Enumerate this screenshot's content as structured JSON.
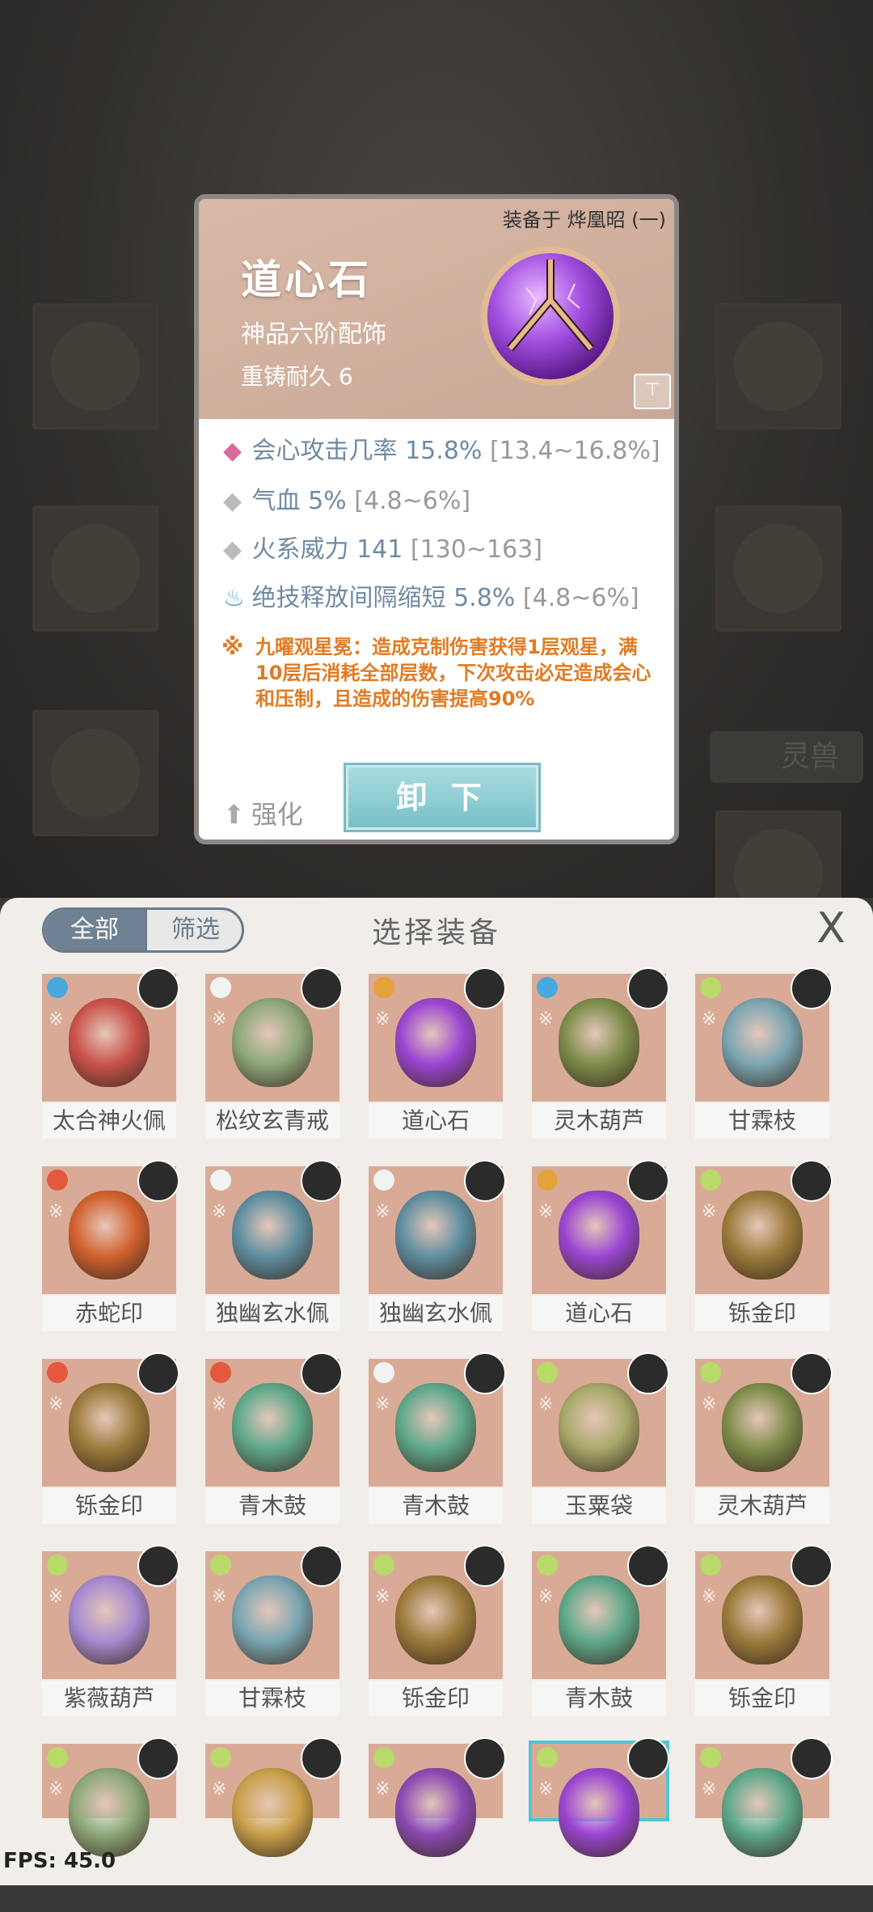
{
  "detail": {
    "equipped_on": "装备于 烨凰昭 (一)",
    "name": "道心石",
    "grade": "神品六阶配饰",
    "durability": "重铸耐久 6",
    "stats": [
      {
        "name": "会心攻击几率 15.8%",
        "range": "[13.4~16.8%]"
      },
      {
        "name": "气血 5%",
        "range": "[4.8~6%]"
      },
      {
        "name": "火系威力 141",
        "range": "[130~163]"
      },
      {
        "name": "绝技释放间隔缩短 5.8%",
        "range": "[4.8~6%]"
      }
    ],
    "effect": "九曜观星冕：造成克制伤害获得1层观星，满10层后消耗全部层数，下次攻击必定造成会心和压制，且造成的伤害提高90%",
    "upgrade_label": "强化",
    "unequip_label": "卸 下"
  },
  "background": {
    "tab_label": "灵兽"
  },
  "panel": {
    "title": "选择装备",
    "tab_all": "全部",
    "tab_filter": "筛选",
    "close_label": "X"
  },
  "items": [
    {
      "name": "太合神火佩",
      "element": "#49a8dd",
      "color": "#c9524a"
    },
    {
      "name": "松纹玄青戒",
      "element": "#f2f2f2",
      "color": "#8ea87a"
    },
    {
      "name": "道心石",
      "element": "#e6a23a",
      "color": "#9a45d2"
    },
    {
      "name": "灵木葫芦",
      "element": "#49a8dd",
      "color": "#7d8c4a"
    },
    {
      "name": "甘霖枝",
      "element": "#b9d96a",
      "color": "#7aa6b2"
    },
    {
      "name": "赤蛇印",
      "element": "#e4583e",
      "color": "#d1612e"
    },
    {
      "name": "独幽玄水佩",
      "element": "#f2f2f2",
      "color": "#5e8ea0"
    },
    {
      "name": "独幽玄水佩",
      "element": "#f2f2f2",
      "color": "#5e8ea0"
    },
    {
      "name": "道心石",
      "element": "#e6a23a",
      "color": "#9a45d2"
    },
    {
      "name": "铄金印",
      "element": "#b9d96a",
      "color": "#9b7a3a"
    },
    {
      "name": "铄金印",
      "element": "#e4583e",
      "color": "#9b7a3a"
    },
    {
      "name": "青木鼓",
      "element": "#e4583e",
      "color": "#5ea88a"
    },
    {
      "name": "青木鼓",
      "element": "#f2f2f2",
      "color": "#5ea88a"
    },
    {
      "name": "玉粟袋",
      "element": "#b9d96a",
      "color": "#a8a86a"
    },
    {
      "name": "灵木葫芦",
      "element": "#b9d96a",
      "color": "#7d8c4a"
    },
    {
      "name": "紫薇葫芦",
      "element": "#b9d96a",
      "color": "#a68ad0"
    },
    {
      "name": "甘霖枝",
      "element": "#b9d96a",
      "color": "#7aa6b2"
    },
    {
      "name": "铄金印",
      "element": "#b9d96a",
      "color": "#9b7a3a"
    },
    {
      "name": "青木鼓",
      "element": "#b9d96a",
      "color": "#5ea88a"
    },
    {
      "name": "铄金印",
      "element": "#b9d96a",
      "color": "#9b7a3a"
    },
    {
      "name": "",
      "element": "#b9d96a",
      "color": "#8ea87a"
    },
    {
      "name": "",
      "element": "#b9d96a",
      "color": "#c9a04a"
    },
    {
      "name": "",
      "element": "#b9d96a",
      "color": "#8a4ab2"
    },
    {
      "name": "",
      "element": "#b9d96a",
      "color": "#9a45d2"
    },
    {
      "name": "",
      "element": "#b9d96a",
      "color": "#5ea88a"
    }
  ],
  "fps": "FPS: 45.0"
}
